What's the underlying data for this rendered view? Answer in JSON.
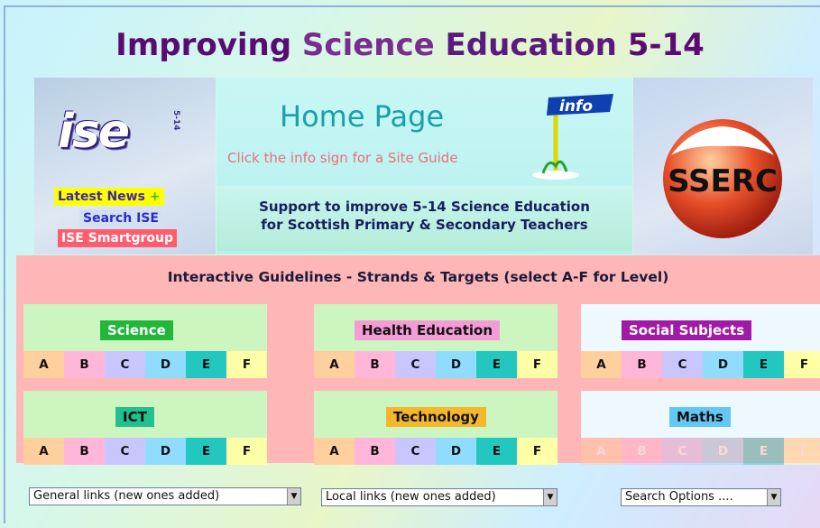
{
  "header": {
    "title_part1": "Improving",
    "title_part2": "Science",
    "title_part3": "Education",
    "title_part4": "5-14"
  },
  "left_panel": {
    "logo_text": "ise",
    "logo_sub": "5-14",
    "links": [
      {
        "label": "Latest News",
        "suffix": "+"
      },
      {
        "label": "Search ISE"
      },
      {
        "label": "ISE Smartgroup"
      }
    ]
  },
  "center_panel": {
    "heading": "Home Page",
    "guide_text": "Click the info sign for a Site Guide",
    "info_sign": "info",
    "support_line1": "Support to improve 5-14 Science Education",
    "support_line2": "for Scottish Primary & Secondary Teachers"
  },
  "right_panel": {
    "logo_text": "SSERC"
  },
  "guidelines": {
    "title": "Interactive Guidelines - Strands & Targets (select A-F for Level)",
    "level_labels": [
      "A",
      "B",
      "C",
      "D",
      "E",
      "F"
    ],
    "subjects": [
      {
        "name": "Science",
        "label_bg": "#22b73a",
        "label_color": "#ffffff",
        "head_bg": "#ccf5c0"
      },
      {
        "name": "Health Education",
        "label_bg": "#f59bd6",
        "label_color": "#111111",
        "head_bg": "#ccf5c0"
      },
      {
        "name": "Social Subjects",
        "label_bg": "#a11aa6",
        "label_color": "#ffffff",
        "head_bg": "#eef9ff"
      },
      {
        "name": "ICT",
        "label_bg": "#22c08e",
        "label_color": "#111111",
        "head_bg": "#ccf5c0"
      },
      {
        "name": "Technology",
        "label_bg": "#f5b82a",
        "label_color": "#111111",
        "head_bg": "#ccf5c0"
      },
      {
        "name": "Maths",
        "label_bg": "#63c7f5",
        "label_color": "#111111",
        "head_bg": "#eef9ff",
        "faded": true
      }
    ],
    "level_colors": [
      "#ffcf9e",
      "#ffb6d9",
      "#c9c6ff",
      "#8fdcff",
      "#22c8c0",
      "#ffffa8"
    ]
  },
  "dropdowns": [
    {
      "value": "General links (new ones added)"
    },
    {
      "value": "Local links (new ones added)"
    },
    {
      "value": "Search Options ...."
    }
  ]
}
